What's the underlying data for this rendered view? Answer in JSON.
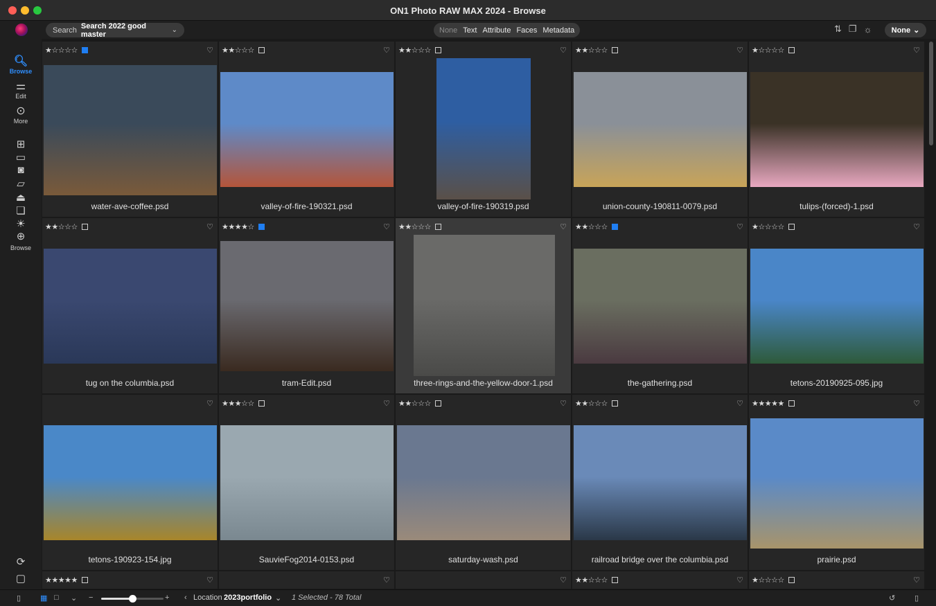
{
  "window": {
    "title": "ON1 Photo RAW MAX 2024 - Browse"
  },
  "toolbar": {
    "search_label": "Search",
    "search_value": "Search 2022 good master",
    "filters": [
      "None",
      "Text",
      "Attribute",
      "Faces",
      "Metadata"
    ],
    "right_dropdown": "None",
    "icons": [
      "sort-icon",
      "compare-icon",
      "brightness-icon"
    ]
  },
  "sidebar": {
    "browse": "Browse",
    "edit": "Edit",
    "more": "More",
    "extensions_label": "Browse"
  },
  "grid": {
    "cells": [
      {
        "stars": "★☆☆☆☆",
        "label": "blue",
        "name": "water-ave-coffee.psd",
        "colors": [
          "#3a4a5a",
          "#7a5a3a"
        ]
      },
      {
        "stars": "★★☆☆☆",
        "label": "none",
        "name": "valley-of-fire-190321.psd",
        "colors": [
          "#5e8ac8",
          "#b4553a"
        ]
      },
      {
        "stars": "★★☆☆☆",
        "label": "none",
        "name": "valley-of-fire-190319.psd",
        "colors": [
          "#2e5ea2",
          "#5a5048"
        ]
      },
      {
        "stars": "★★☆☆☆",
        "label": "none",
        "name": "union-county-190811-0079.psd",
        "colors": [
          "#8a9098",
          "#c8a458"
        ]
      },
      {
        "stars": "★☆☆☆☆",
        "label": "none",
        "name": "tulips-(forced)-1.psd",
        "colors": [
          "#3a3226",
          "#e8a8c0"
        ]
      },
      {
        "stars": "★★☆☆☆",
        "label": "none",
        "name": "tug on the columbia.psd",
        "colors": [
          "#3a4870",
          "#2a3858"
        ]
      },
      {
        "stars": "★★★★☆",
        "label": "blue",
        "name": "tram-Edit.psd",
        "colors": [
          "#6a6a70",
          "#3a2a20"
        ]
      },
      {
        "stars": "★★☆☆☆",
        "label": "none",
        "name": "three-rings-and-the-yellow-door-1.psd",
        "colors": [
          "#6a6a68",
          "#4a4a48"
        ]
      },
      {
        "stars": "★★☆☆☆",
        "label": "blue",
        "name": "the-gathering.psd",
        "colors": [
          "#6a6e60",
          "#4a3a40"
        ]
      },
      {
        "stars": "★☆☆☆☆",
        "label": "none",
        "name": "tetons-20190925-095.jpg",
        "colors": [
          "#4a86c8",
          "#2e5a3a"
        ]
      },
      {
        "stars": "",
        "label": "hidden",
        "name": "tetons-190923-154.jpg",
        "colors": [
          "#4a88c8",
          "#a8862a"
        ]
      },
      {
        "stars": "★★★☆☆",
        "label": "none",
        "name": "SauvieFog2014-0153.psd",
        "colors": [
          "#9aa8b0",
          "#7a8890"
        ]
      },
      {
        "stars": "★★☆☆☆",
        "label": "none",
        "name": "saturday-wash.psd",
        "colors": [
          "#6a7890",
          "#9a8a7a"
        ]
      },
      {
        "stars": "★★☆☆☆",
        "label": "none",
        "name": "railroad bridge over the columbia.psd",
        "colors": [
          "#6a8ab8",
          "#2a3848"
        ]
      },
      {
        "stars": "★★★★★",
        "label": "none",
        "name": "prairie.psd",
        "colors": [
          "#5a8ac8",
          "#a8946a"
        ]
      }
    ],
    "partial_row": [
      {
        "stars": "★★★★★",
        "label": "none"
      },
      {
        "stars": "",
        "label": "hidden"
      },
      {
        "stars": "",
        "label": "hidden"
      },
      {
        "stars": "★★☆☆☆",
        "label": "none"
      },
      {
        "stars": "★☆☆☆☆",
        "label": "none"
      }
    ]
  },
  "statusbar": {
    "location_label": "Location",
    "location_value": "2023portfolio",
    "selection": "1 Selected - 78 Total"
  }
}
